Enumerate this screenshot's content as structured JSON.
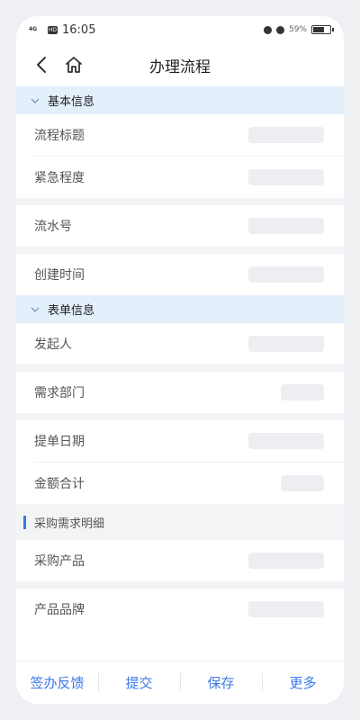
{
  "status": {
    "time": "16:05",
    "network": "4G",
    "hd": "HD",
    "battery": "59%",
    "battery_level": 0.59
  },
  "navbar": {
    "title": "办理流程"
  },
  "sections": {
    "basic": {
      "title": "基本信息",
      "fields": [
        "流程标题",
        "紧急程度",
        "流水号",
        "创建时间"
      ]
    },
    "form": {
      "title": "表单信息",
      "fields": [
        "发起人",
        "需求部门",
        "提单日期",
        "金额合计"
      ]
    },
    "purchase": {
      "title": "采购需求明细",
      "fields": [
        "采购产品",
        "产品品牌"
      ]
    }
  },
  "actions": {
    "feedback": "签办反馈",
    "submit": "提交",
    "save": "保存",
    "more": "更多"
  },
  "colors": {
    "accent": "#3b78e7",
    "section_bg": "#e3effb"
  }
}
